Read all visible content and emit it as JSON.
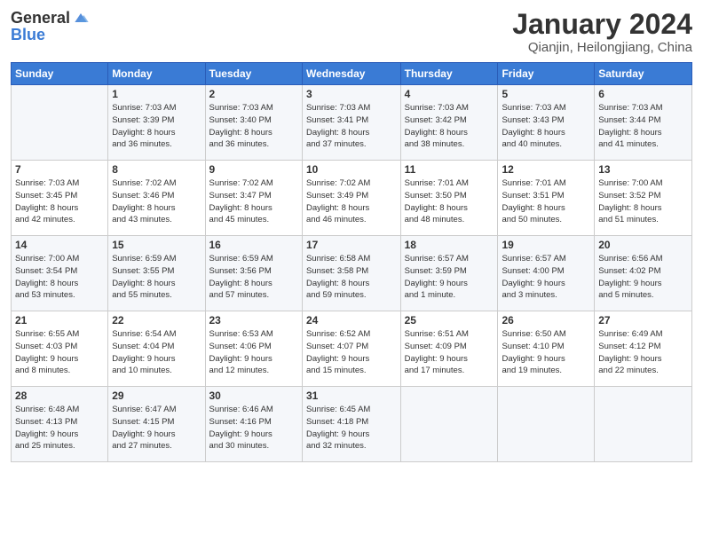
{
  "header": {
    "logo_general": "General",
    "logo_blue": "Blue",
    "title": "January 2024",
    "location": "Qianjin, Heilongjiang, China"
  },
  "weekdays": [
    "Sunday",
    "Monday",
    "Tuesday",
    "Wednesday",
    "Thursday",
    "Friday",
    "Saturday"
  ],
  "weeks": [
    [
      {
        "day": "",
        "info": ""
      },
      {
        "day": "1",
        "info": "Sunrise: 7:03 AM\nSunset: 3:39 PM\nDaylight: 8 hours\nand 36 minutes."
      },
      {
        "day": "2",
        "info": "Sunrise: 7:03 AM\nSunset: 3:40 PM\nDaylight: 8 hours\nand 36 minutes."
      },
      {
        "day": "3",
        "info": "Sunrise: 7:03 AM\nSunset: 3:41 PM\nDaylight: 8 hours\nand 37 minutes."
      },
      {
        "day": "4",
        "info": "Sunrise: 7:03 AM\nSunset: 3:42 PM\nDaylight: 8 hours\nand 38 minutes."
      },
      {
        "day": "5",
        "info": "Sunrise: 7:03 AM\nSunset: 3:43 PM\nDaylight: 8 hours\nand 40 minutes."
      },
      {
        "day": "6",
        "info": "Sunrise: 7:03 AM\nSunset: 3:44 PM\nDaylight: 8 hours\nand 41 minutes."
      }
    ],
    [
      {
        "day": "7",
        "info": "Sunrise: 7:03 AM\nSunset: 3:45 PM\nDaylight: 8 hours\nand 42 minutes."
      },
      {
        "day": "8",
        "info": "Sunrise: 7:02 AM\nSunset: 3:46 PM\nDaylight: 8 hours\nand 43 minutes."
      },
      {
        "day": "9",
        "info": "Sunrise: 7:02 AM\nSunset: 3:47 PM\nDaylight: 8 hours\nand 45 minutes."
      },
      {
        "day": "10",
        "info": "Sunrise: 7:02 AM\nSunset: 3:49 PM\nDaylight: 8 hours\nand 46 minutes."
      },
      {
        "day": "11",
        "info": "Sunrise: 7:01 AM\nSunset: 3:50 PM\nDaylight: 8 hours\nand 48 minutes."
      },
      {
        "day": "12",
        "info": "Sunrise: 7:01 AM\nSunset: 3:51 PM\nDaylight: 8 hours\nand 50 minutes."
      },
      {
        "day": "13",
        "info": "Sunrise: 7:00 AM\nSunset: 3:52 PM\nDaylight: 8 hours\nand 51 minutes."
      }
    ],
    [
      {
        "day": "14",
        "info": "Sunrise: 7:00 AM\nSunset: 3:54 PM\nDaylight: 8 hours\nand 53 minutes."
      },
      {
        "day": "15",
        "info": "Sunrise: 6:59 AM\nSunset: 3:55 PM\nDaylight: 8 hours\nand 55 minutes."
      },
      {
        "day": "16",
        "info": "Sunrise: 6:59 AM\nSunset: 3:56 PM\nDaylight: 8 hours\nand 57 minutes."
      },
      {
        "day": "17",
        "info": "Sunrise: 6:58 AM\nSunset: 3:58 PM\nDaylight: 8 hours\nand 59 minutes."
      },
      {
        "day": "18",
        "info": "Sunrise: 6:57 AM\nSunset: 3:59 PM\nDaylight: 9 hours\nand 1 minute."
      },
      {
        "day": "19",
        "info": "Sunrise: 6:57 AM\nSunset: 4:00 PM\nDaylight: 9 hours\nand 3 minutes."
      },
      {
        "day": "20",
        "info": "Sunrise: 6:56 AM\nSunset: 4:02 PM\nDaylight: 9 hours\nand 5 minutes."
      }
    ],
    [
      {
        "day": "21",
        "info": "Sunrise: 6:55 AM\nSunset: 4:03 PM\nDaylight: 9 hours\nand 8 minutes."
      },
      {
        "day": "22",
        "info": "Sunrise: 6:54 AM\nSunset: 4:04 PM\nDaylight: 9 hours\nand 10 minutes."
      },
      {
        "day": "23",
        "info": "Sunrise: 6:53 AM\nSunset: 4:06 PM\nDaylight: 9 hours\nand 12 minutes."
      },
      {
        "day": "24",
        "info": "Sunrise: 6:52 AM\nSunset: 4:07 PM\nDaylight: 9 hours\nand 15 minutes."
      },
      {
        "day": "25",
        "info": "Sunrise: 6:51 AM\nSunset: 4:09 PM\nDaylight: 9 hours\nand 17 minutes."
      },
      {
        "day": "26",
        "info": "Sunrise: 6:50 AM\nSunset: 4:10 PM\nDaylight: 9 hours\nand 19 minutes."
      },
      {
        "day": "27",
        "info": "Sunrise: 6:49 AM\nSunset: 4:12 PM\nDaylight: 9 hours\nand 22 minutes."
      }
    ],
    [
      {
        "day": "28",
        "info": "Sunrise: 6:48 AM\nSunset: 4:13 PM\nDaylight: 9 hours\nand 25 minutes."
      },
      {
        "day": "29",
        "info": "Sunrise: 6:47 AM\nSunset: 4:15 PM\nDaylight: 9 hours\nand 27 minutes."
      },
      {
        "day": "30",
        "info": "Sunrise: 6:46 AM\nSunset: 4:16 PM\nDaylight: 9 hours\nand 30 minutes."
      },
      {
        "day": "31",
        "info": "Sunrise: 6:45 AM\nSunset: 4:18 PM\nDaylight: 9 hours\nand 32 minutes."
      },
      {
        "day": "",
        "info": ""
      },
      {
        "day": "",
        "info": ""
      },
      {
        "day": "",
        "info": ""
      }
    ]
  ]
}
